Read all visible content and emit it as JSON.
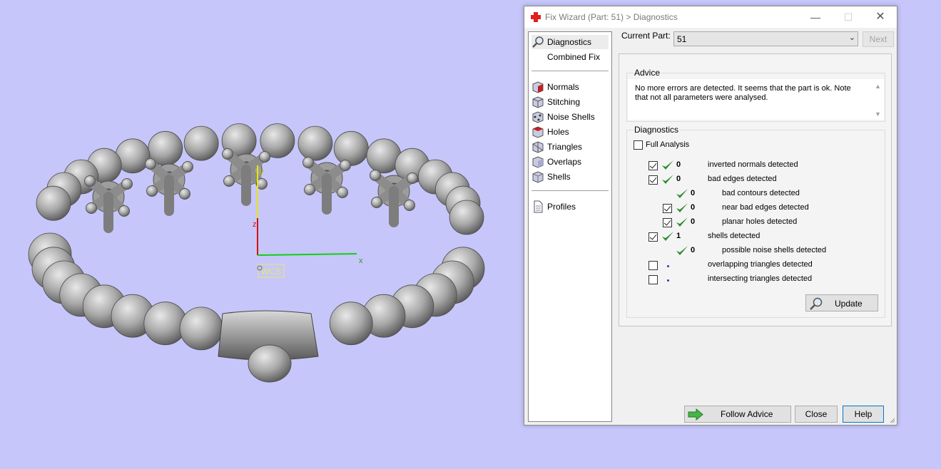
{
  "dialog": {
    "title": "Fix Wizard (Part: 51) > Diagnostics",
    "min_glyph": "—",
    "max_glyph": "☐",
    "close_glyph": "✕"
  },
  "nav": {
    "top_items": [
      {
        "label": "Diagnostics",
        "icon": "magnifier-icon",
        "selected": true
      },
      {
        "label": "Combined Fix",
        "icon": "none"
      }
    ],
    "tool_items": [
      {
        "label": "Normals",
        "icon": "normals-cube-icon"
      },
      {
        "label": "Stitching",
        "icon": "stitching-cube-icon"
      },
      {
        "label": "Noise Shells",
        "icon": "noise-shells-cube-icon"
      },
      {
        "label": "Holes",
        "icon": "holes-cube-icon"
      },
      {
        "label": "Triangles",
        "icon": "triangles-cube-icon"
      },
      {
        "label": "Overlaps",
        "icon": "overlaps-cube-icon"
      },
      {
        "label": "Shells",
        "icon": "shells-cube-icon"
      }
    ],
    "profiles": {
      "label": "Profiles",
      "icon": "document-icon"
    }
  },
  "current_part": {
    "label": "Current Part:",
    "value": "51",
    "next_label": "Next"
  },
  "advice": {
    "title": "Advice",
    "text": "No more errors are detected. It seems that the part is ok. Note that not all parameters were analysed."
  },
  "diagnostics": {
    "title": "Diagnostics",
    "full_analysis_label": "Full Analysis",
    "full_analysis_checked": false,
    "rows": [
      {
        "label": "inverted normals detected",
        "count": "0",
        "checkbox": true,
        "checked": true,
        "status": "ok",
        "indent": 0
      },
      {
        "label": "bad edges detected",
        "count": "0",
        "checkbox": true,
        "checked": true,
        "status": "ok",
        "indent": 0
      },
      {
        "label": "bad contours detected",
        "count": "0",
        "checkbox": false,
        "checked": false,
        "status": "ok",
        "indent": 1
      },
      {
        "label": "near bad edges detected",
        "count": "0",
        "checkbox": true,
        "checked": true,
        "status": "ok",
        "indent": 1
      },
      {
        "label": "planar holes detected",
        "count": "0",
        "checkbox": true,
        "checked": true,
        "status": "ok",
        "indent": 1
      },
      {
        "label": "shells detected",
        "count": "1",
        "checkbox": true,
        "checked": true,
        "status": "ok",
        "indent": 0
      },
      {
        "label": "possible noise shells detected",
        "count": "0",
        "checkbox": false,
        "checked": false,
        "status": "ok",
        "indent": 1
      },
      {
        "label": "overlapping triangles detected",
        "count": "",
        "checkbox": true,
        "checked": false,
        "status": "pending",
        "indent": 0
      },
      {
        "label": "intersecting triangles detected",
        "count": "",
        "checkbox": true,
        "checked": false,
        "status": "pending",
        "indent": 0
      }
    ],
    "update_label": "Update"
  },
  "buttons": {
    "follow_advice": "Follow Advice",
    "close": "Close",
    "help": "Help"
  },
  "viewport": {
    "background": "#c6c6fa",
    "axes": {
      "x": "x",
      "y": "y",
      "z": "z",
      "wcs": "WCS"
    }
  },
  "colors": {
    "check_green": "#2e8b2e",
    "accent_blue": "#0078d7",
    "title_red": "#e02020"
  }
}
